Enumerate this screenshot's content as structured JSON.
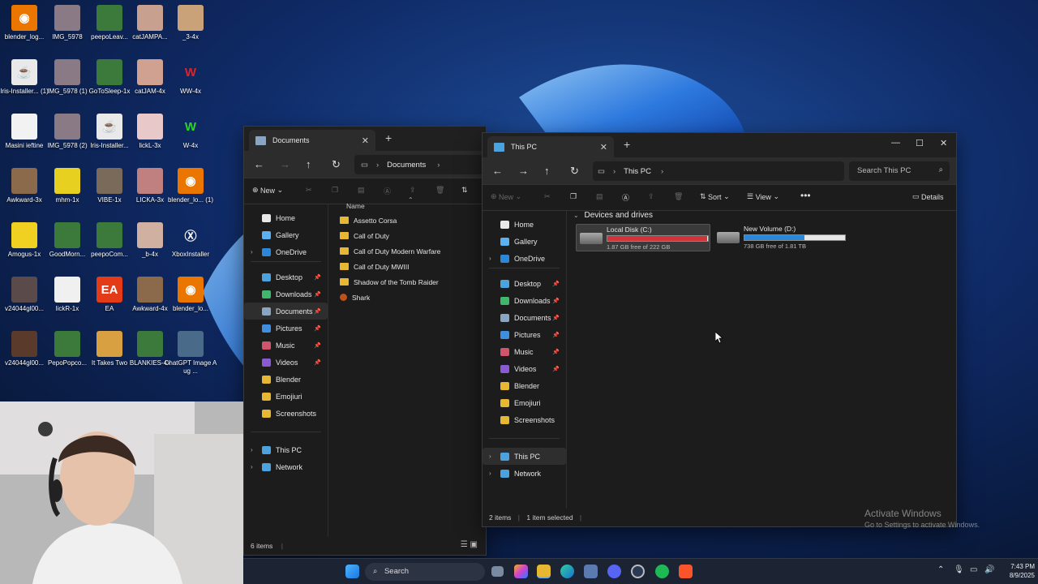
{
  "desktop": {
    "icons": [
      {
        "label": "blender_log...",
        "color": "#ea7600",
        "glyph": "◉"
      },
      {
        "label": "IMG_5978",
        "color": "#8a7a86",
        "glyph": ""
      },
      {
        "label": "peepoLeav...",
        "color": "#3b7a3b",
        "glyph": ""
      },
      {
        "label": "catJAMPA...",
        "color": "#c8a090",
        "glyph": ""
      },
      {
        "label": "_3-4x",
        "color": "#c9a27a",
        "glyph": ""
      },
      {
        "label": "Iris-Installer... (1)",
        "color": "#e9e9e9",
        "glyph": "☕"
      },
      {
        "label": "IMG_5978 (1)",
        "color": "#8a7a86",
        "glyph": ""
      },
      {
        "label": "GoToSleep-1x",
        "color": "#3b7a3b",
        "glyph": ""
      },
      {
        "label": "catJAM-4x",
        "color": "#d0a090",
        "glyph": ""
      },
      {
        "label": "WW-4x",
        "color": "transparent",
        "glyph": "W",
        "gcolor": "#e0212a"
      },
      {
        "label": "Masini ieftine",
        "color": "#f2f2f2",
        "glyph": ""
      },
      {
        "label": "IMG_5978 (2)",
        "color": "#8a7a86",
        "glyph": ""
      },
      {
        "label": "Iris-Installer...",
        "color": "#e9e9e9",
        "glyph": "☕"
      },
      {
        "label": "lickL-3x",
        "color": "#e8c8c8",
        "glyph": ""
      },
      {
        "label": "W-4x",
        "color": "transparent",
        "glyph": "W",
        "gcolor": "#2ad52a"
      },
      {
        "label": "Awkward-3x",
        "color": "#8a6a4a",
        "glyph": ""
      },
      {
        "label": "mhm-1x",
        "color": "#e8d020",
        "glyph": ""
      },
      {
        "label": "VIBE-1x",
        "color": "#7a6a5a",
        "glyph": ""
      },
      {
        "label": "LICKA-3x",
        "color": "#c08080",
        "glyph": ""
      },
      {
        "label": "blender_lo... (1)",
        "color": "#ea7600",
        "glyph": "◉"
      },
      {
        "label": "Amogus-1x",
        "color": "#f0d020",
        "glyph": ""
      },
      {
        "label": "GoodMorn...",
        "color": "#3b7a3b",
        "glyph": ""
      },
      {
        "label": "peepoCom...",
        "color": "#3b7a3b",
        "glyph": ""
      },
      {
        "label": "_b-4x",
        "color": "#d0b0a0",
        "glyph": ""
      },
      {
        "label": "XboxInstaller",
        "color": "transparent",
        "glyph": "Ⓧ",
        "gcolor": "#ffffff"
      },
      {
        "label": "v24044gl00...",
        "color": "#5a4a4a",
        "glyph": ""
      },
      {
        "label": "lickR-1x",
        "color": "#f0f0f0",
        "glyph": ""
      },
      {
        "label": "EA",
        "color": "#e33a18",
        "glyph": "EA",
        "gcolor": "#ffffff"
      },
      {
        "label": "Awkward-4x",
        "color": "#8a6a4a",
        "glyph": ""
      },
      {
        "label": "blender_lo...",
        "color": "#ea7600",
        "glyph": "◉"
      },
      {
        "label": "v24044gl00...",
        "color": "#5a3a2a",
        "glyph": ""
      },
      {
        "label": "PepoPopco...",
        "color": "#3b7a3b",
        "glyph": ""
      },
      {
        "label": "It Takes Two",
        "color": "#d8a040",
        "glyph": ""
      },
      {
        "label": "BLANKIES-4x",
        "color": "#3b7a3b",
        "glyph": ""
      },
      {
        "label": "ChatGPT Image Aug ...",
        "color": "#4a6a8a",
        "glyph": ""
      }
    ]
  },
  "documents_window": {
    "tab_title": "Documents",
    "breadcrumb": "Documents",
    "new_label": "New",
    "column_name": "Name",
    "nav": [
      {
        "label": "Home",
        "icon": "home-icon",
        "color": "#e8e8e8"
      },
      {
        "label": "Gallery",
        "icon": "gallery-icon",
        "color": "#5ab0f0"
      },
      {
        "label": "OneDrive",
        "icon": "cloud-icon",
        "color": "#2b88d8"
      },
      {
        "label": "Desktop",
        "icon": "desktop-icon",
        "color": "#4aa3df"
      },
      {
        "label": "Downloads",
        "icon": "download-icon",
        "color": "#3fb86b"
      },
      {
        "label": "Documents",
        "icon": "document-icon",
        "color": "#8aa4c4"
      },
      {
        "label": "Pictures",
        "icon": "pictures-icon",
        "color": "#3f8fe0"
      },
      {
        "label": "Music",
        "icon": "music-icon",
        "color": "#d0546a"
      },
      {
        "label": "Videos",
        "icon": "video-icon",
        "color": "#8a5ad0"
      },
      {
        "label": "Blender",
        "icon": "folder-icon",
        "color": "#e8b731"
      },
      {
        "label": "Emojiuri",
        "icon": "folder-icon",
        "color": "#e8b731"
      },
      {
        "label": "Screenshots",
        "icon": "folder-icon",
        "color": "#e8b731"
      },
      {
        "label": "This PC",
        "icon": "pc-icon",
        "color": "#4aa3df"
      },
      {
        "label": "Network",
        "icon": "network-icon",
        "color": "#4aa3df"
      }
    ],
    "files": [
      "Assetto Corsa",
      "Call of Duty",
      "Call of Duty Modern Warfare",
      "Call of Duty MWIII",
      "Shadow of the Tomb Raider",
      "Shark"
    ],
    "status": "6 items"
  },
  "thispc_window": {
    "tab_title": "This PC",
    "breadcrumb": "This PC",
    "search_placeholder": "Search This PC",
    "commands": {
      "new": "New",
      "sort": "Sort",
      "view": "View",
      "details": "Details"
    },
    "nav": [
      {
        "label": "Home",
        "icon": "home-icon",
        "color": "#e8e8e8"
      },
      {
        "label": "Gallery",
        "icon": "gallery-icon",
        "color": "#5ab0f0"
      },
      {
        "label": "OneDrive",
        "icon": "cloud-icon",
        "color": "#2b88d8"
      },
      {
        "label": "Desktop",
        "icon": "desktop-icon",
        "color": "#4aa3df"
      },
      {
        "label": "Downloads",
        "icon": "download-icon",
        "color": "#3fb86b"
      },
      {
        "label": "Documents",
        "icon": "document-icon",
        "color": "#8aa4c4"
      },
      {
        "label": "Pictures",
        "icon": "pictures-icon",
        "color": "#3f8fe0"
      },
      {
        "label": "Music",
        "icon": "music-icon",
        "color": "#d0546a"
      },
      {
        "label": "Videos",
        "icon": "video-icon",
        "color": "#8a5ad0"
      },
      {
        "label": "Blender",
        "icon": "folder-icon",
        "color": "#e8b731"
      },
      {
        "label": "Emojiuri",
        "icon": "folder-icon",
        "color": "#e8b731"
      },
      {
        "label": "Screenshots",
        "icon": "folder-icon",
        "color": "#e8b731"
      },
      {
        "label": "This PC",
        "icon": "pc-icon",
        "color": "#4aa3df"
      },
      {
        "label": "Network",
        "icon": "network-icon",
        "color": "#4aa3df"
      }
    ],
    "section_title": "Devices and drives",
    "drives": [
      {
        "name": "Local Disk (C:)",
        "free": "1.87 GB free of 222 GB",
        "used_fraction": 0.99,
        "bar_color": "#d13438",
        "selected": true
      },
      {
        "name": "New Volume (D:)",
        "free": "738 GB free of 1.81 TB",
        "used_fraction": 0.6,
        "bar_color": "#2b88d8",
        "selected": false
      }
    ],
    "status_items": "2 items",
    "status_selected": "1 item selected"
  },
  "watermark": {
    "line1": "Activate Windows",
    "line2": "Go to Settings to activate Windows."
  },
  "taskbar": {
    "search_label": "Search",
    "time": "7:43 PM",
    "date": "8/9/2025"
  }
}
